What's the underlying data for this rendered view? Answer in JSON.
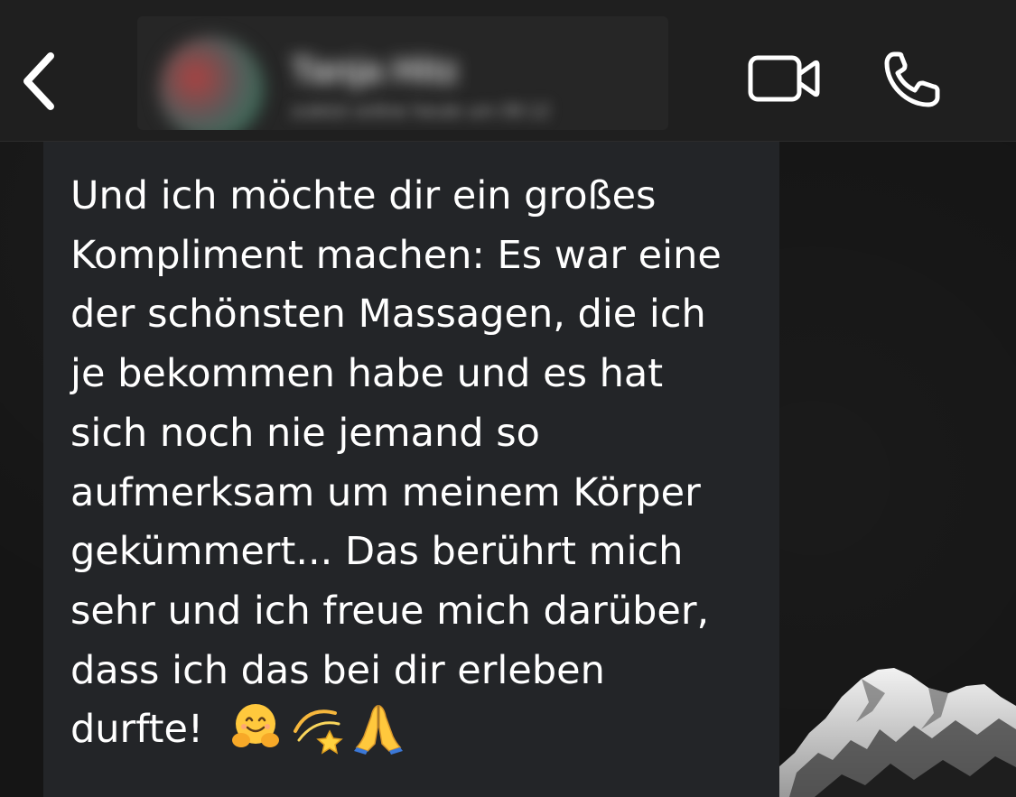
{
  "header": {
    "back_icon": "chevron-left-icon",
    "contact_name": "Tanja Hitz",
    "contact_status": "zuletzt online heute um 08:12",
    "video_icon": "video-camera-icon",
    "call_icon": "phone-icon"
  },
  "message": {
    "lines": [
      "Und ich möchte dir ein großes",
      "Kompliment machen: Es war eine",
      "der schönsten Massagen, die ich",
      "je bekommen habe und es hat",
      "sich noch nie jemand so",
      "aufmerksam um meinem Körper",
      "gekümmert... Das berührt mich",
      "sehr und ich freue mich darüber,",
      "dass ich das bei dir erleben",
      "durfte!"
    ],
    "emojis": [
      "hugging-face-emoji",
      "dizzy-star-emoji",
      "folded-hands-emoji"
    ]
  },
  "colors": {
    "header_bg": "#1f1f1f",
    "bubble_bg": "#232528",
    "text": "#ffffff",
    "icon": "#ffffff"
  }
}
